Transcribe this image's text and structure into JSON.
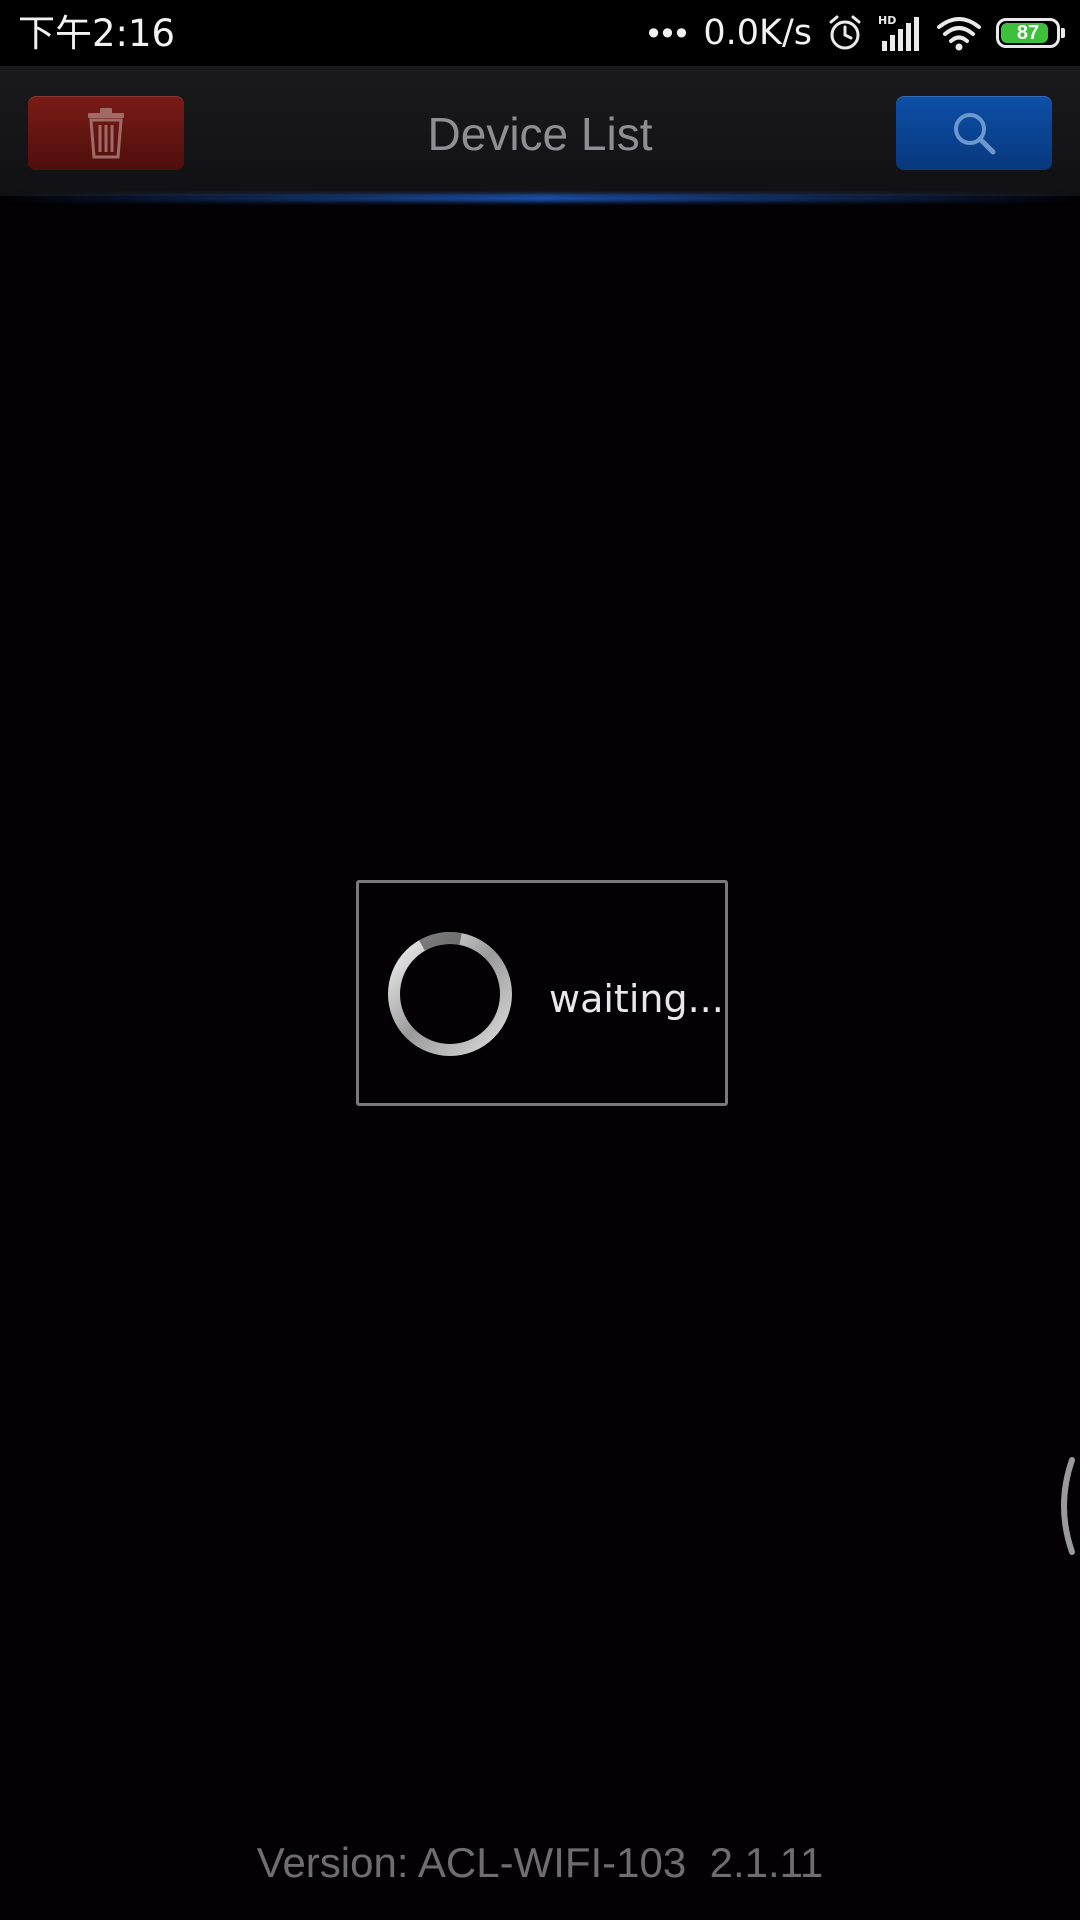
{
  "status_bar": {
    "time": "下午2:16",
    "more_dots": "•••",
    "network_speed": "0.0K/s",
    "battery_level": "87",
    "battery_percent": 87,
    "battery_color": "#3ec13a",
    "icons": [
      "alarm-icon",
      "hd-signal-icon",
      "wifi-icon",
      "battery-icon"
    ]
  },
  "header": {
    "title": "Device List",
    "delete_button_icon": "trash-icon",
    "search_button_icon": "search-icon",
    "delete_button_color": "#6b1612",
    "search_button_color": "#0b47a0"
  },
  "dialog": {
    "message": "waiting..."
  },
  "footer": {
    "version": "Version: ACL-WIFI-103  2.1.11"
  }
}
